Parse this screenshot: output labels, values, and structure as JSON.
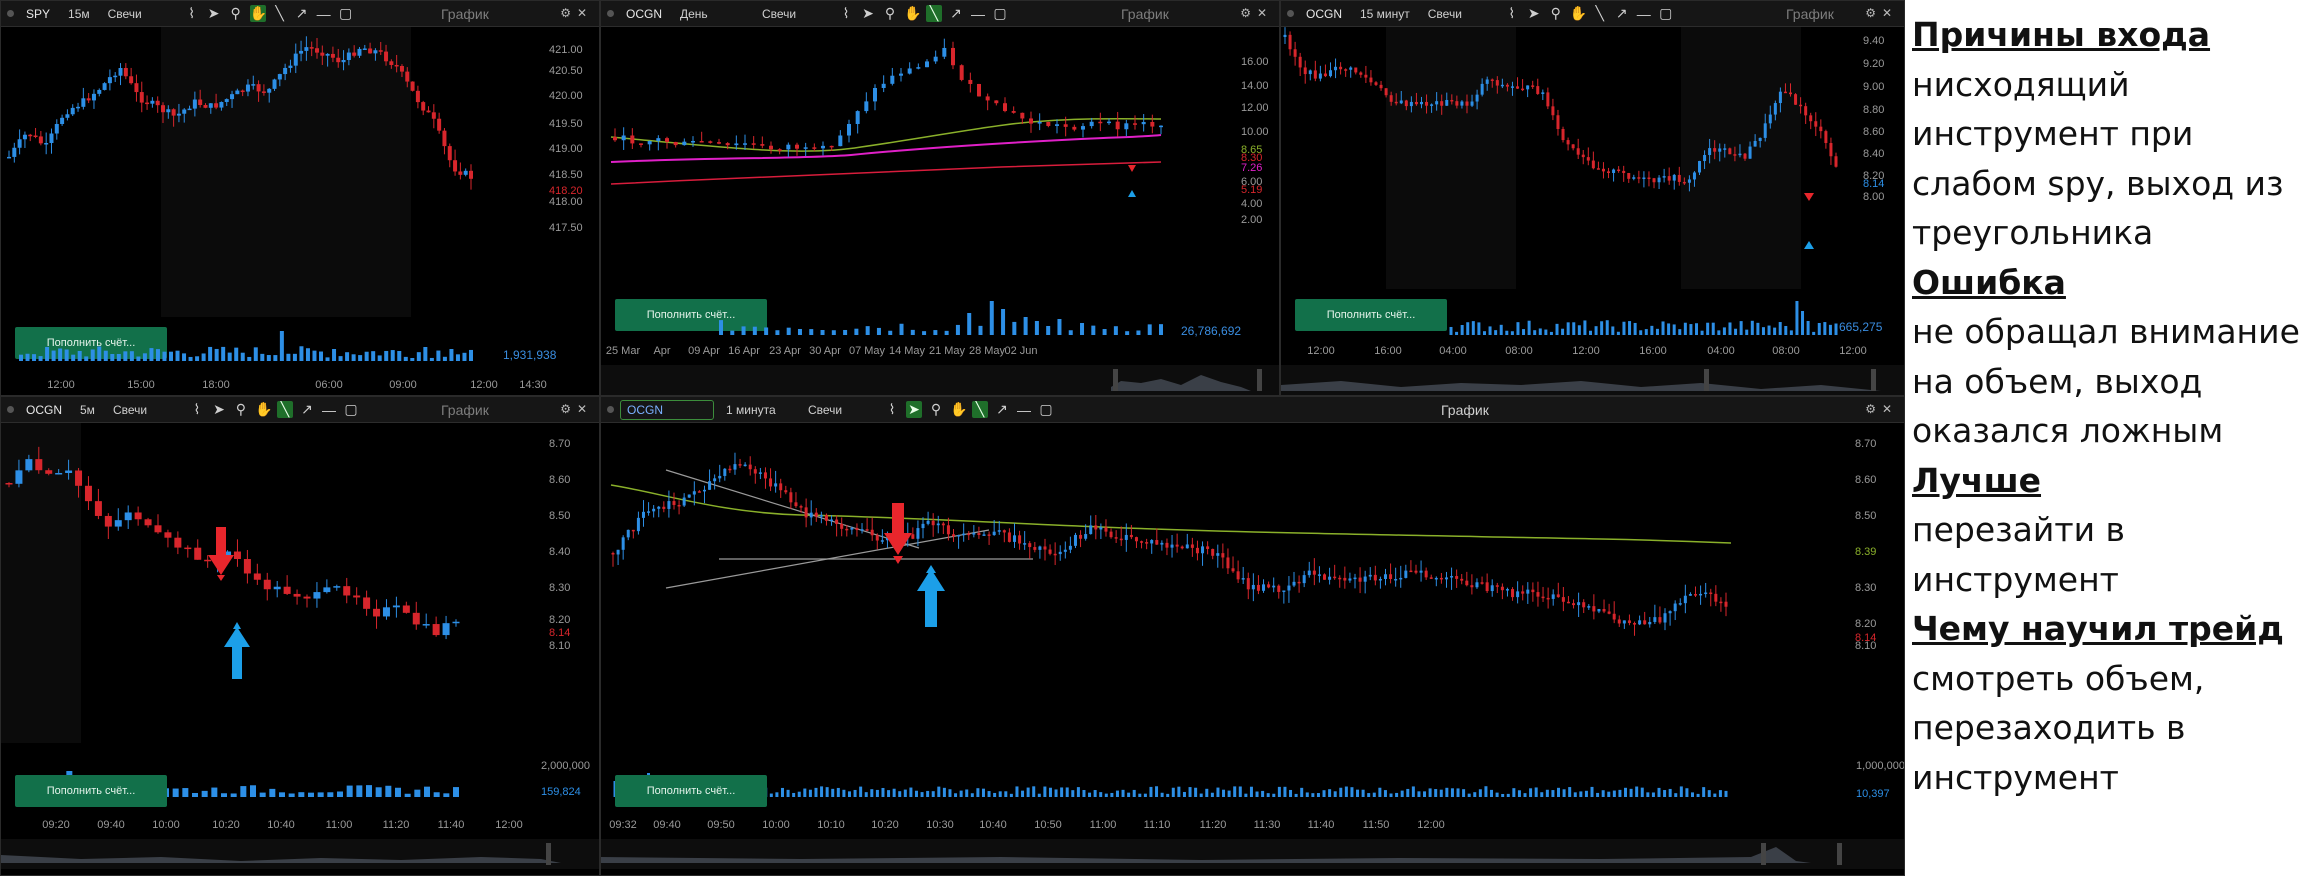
{
  "panels": {
    "spy": {
      "symbol": "SPY",
      "interval": "15м",
      "style": "Свечи",
      "title": "График",
      "price_ticks": [
        "421.00",
        "420.50",
        "420.00",
        "419.50",
        "419.00",
        "418.50",
        "418.20",
        "418.00",
        "417.50"
      ],
      "time_ticks": [
        "12:00",
        "15:00",
        "18:00",
        "06:00",
        "09:00",
        "12:00",
        "14:30"
      ],
      "volume_label": "1,931,938",
      "fund_button": "Пополнить счёт..."
    },
    "ocgn_day": {
      "symbol": "OCGN",
      "interval": "День",
      "style": "Свечи",
      "title": "График",
      "price_ticks": [
        "16.00",
        "14.00",
        "12.00",
        "10.00",
        "8.65",
        "8.30",
        "7.26",
        "6.00",
        "5.19",
        "4.00",
        "2.00"
      ],
      "time_ticks": [
        "25 Mar",
        "Apr",
        "09 Apr",
        "16 Apr",
        "23 Apr",
        "30 Apr",
        "07 May",
        "14 May",
        "21 May",
        "28 May",
        "02 Jun"
      ],
      "volume_label": "26,786,692",
      "fund_button": "Пополнить счёт..."
    },
    "ocgn_15m": {
      "symbol": "OCGN",
      "interval": "15 минут",
      "style": "Свечи",
      "title": "График",
      "price_ticks": [
        "9.40",
        "9.20",
        "9.00",
        "8.80",
        "8.60",
        "8.40",
        "8.20",
        "8.14",
        "8.00"
      ],
      "time_ticks": [
        "12:00",
        "16:00",
        "04:00",
        "08:00",
        "12:00",
        "16:00",
        "04:00",
        "08:00",
        "12:00"
      ],
      "volume_label": "665,275",
      "fund_button": "Пополнить счёт..."
    },
    "ocgn_5m": {
      "symbol": "OCGN",
      "interval": "5м",
      "style": "Свечи",
      "title": "График",
      "price_ticks": [
        "8.70",
        "8.60",
        "8.50",
        "8.40",
        "8.30",
        "8.20",
        "8.14",
        "8.10"
      ],
      "time_ticks": [
        "09:20",
        "09:40",
        "10:00",
        "10:20",
        "10:40",
        "11:00",
        "11:20",
        "11:40",
        "12:00"
      ],
      "volume_ticks": [
        "2,000,000",
        "159,824"
      ],
      "fund_button": "Пополнить счёт..."
    },
    "ocgn_1m": {
      "symbol": "OCGN",
      "interval": "1 минута",
      "style": "Свечи",
      "title": "График",
      "price_ticks": [
        "8.70",
        "8.60",
        "8.50",
        "8.39",
        "8.30",
        "8.20",
        "8.14",
        "8.10"
      ],
      "time_ticks": [
        "09:32",
        "09:40",
        "09:50",
        "10:00",
        "10:10",
        "10:20",
        "10:30",
        "10:40",
        "10:50",
        "11:00",
        "11:10",
        "11:20",
        "11:30",
        "11:40",
        "11:50",
        "12:00"
      ],
      "volume_ticks": [
        "1,000,000",
        "10,397"
      ],
      "fund_button": "Пополнить счёт..."
    }
  },
  "colors": {
    "up": "#2d8fe6",
    "down": "#d8262c",
    "ma_green": "#8ab02a",
    "ma_pink": "#e020c8",
    "ma_red": "#d81d3c",
    "arrow_red": "#e8262c",
    "arrow_blue": "#1c9fe8"
  },
  "notes": {
    "h1": "Причины входа",
    "t1": "нисходящий инструмент при слабом spy, выход из треугольника",
    "h2": "Ошибка",
    "t2": "не обращал внимание на объем, выход оказался ложным",
    "h3": "Лучше",
    "t3": "перезайти в инструмент",
    "h4": "Чему научил трейд",
    "t4": "смотреть объем, перезаходить в инструмент"
  }
}
